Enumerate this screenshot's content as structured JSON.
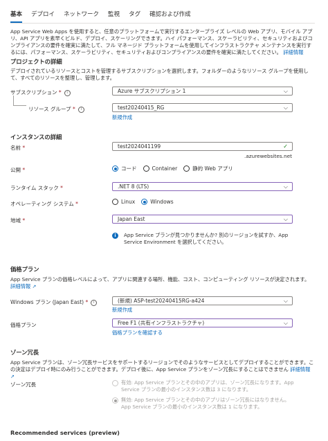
{
  "tabs": [
    "基本",
    "デプロイ",
    "ネットワーク",
    "監視",
    "タグ",
    "確認および作成"
  ],
  "intro": {
    "text": "App Service Web Apps を使用すると、任意のプラットフォームで実行するエンタープライズ レベルの Web アプリ、モバイル アプリ、API アプリを素早くビルド、デプロイ、スケーリングできます。ハイ パフォーマンス、スケーラビリティ、セキュリティおよびコンプライアンスの要件を確実に満たして、フル マネージド プラットフォームを使用してインフラストラクチャ メンテナンスを実行するには、パフォーマンス、スケーラビリティ、セキュリティおよびコンプライアンスの要件を確実に満たしてください。",
    "link": "詳細情報"
  },
  "project": {
    "heading": "プロジェクトの詳細",
    "desc": "デプロイされているリソースとコストを管理するサブスクリプションを選択します。フォルダーのようなリソース グループを使用して、すべてのリソースを整理し、管理します。",
    "subscription_label": "サブスクリプション",
    "subscription_value": "Azure サブスクリプション 1",
    "rg_label": "リソース グループ",
    "rg_value": "test20240415_RG",
    "create_new": "新規作成"
  },
  "instance": {
    "heading": "インスタンスの詳細",
    "name_label": "名前",
    "name_value": "test2024041199",
    "domain_suffix": ".azurewebsites.net",
    "publish_label": "公開",
    "publish_options": [
      "コード",
      "Container",
      "静的 Web アプリ"
    ],
    "publish_selected": "コード",
    "runtime_label": "ランタイム スタック",
    "runtime_value": ".NET 8 (LTS)",
    "os_label": "オペレーティング システム",
    "os_options": [
      "Linux",
      "Windows"
    ],
    "os_selected": "Windows",
    "region_label": "地域",
    "region_value": "Japan East",
    "region_info": "App Service プランが見つかりませんか? 別のリージョンを試すか、App Service Environment を選択してください。"
  },
  "pricing": {
    "heading": "価格プラン",
    "desc": "App Service プランの価格レベルによって、アプリに関連する場所、機能、コスト、コンピューティング リソースが決定されます。",
    "link": "詳細情報",
    "plan_label": "Windows プラン (Japan East)",
    "plan_value": "(新規) ASP-test20240415RG-a424",
    "create_new": "新規作成",
    "tier_label": "価格プラン",
    "tier_value": "Free F1 (共有インフラストラクチャ)",
    "explore": "価格プランを確認する"
  },
  "zone": {
    "heading": "ゾーン冗長",
    "desc": "App Service プランは、ゾーン冗長サービスをサポートするリージョンでそのようなサービスとしてデプロイすることができます。この決定はデプロイ時にのみ行うことができます。デプロイ後に、App Service プランをゾーン冗長にすることはできません",
    "link": "詳細情報",
    "label": "ゾーン冗長",
    "enabled": "有効: App Service プランとその中のアプリは、ゾーン冗長になります。App Service プランの最小のインスタンス数は 3 になります。",
    "disabled": "無効: App Service プランとその中のアプリはゾーン冗長にはなりません。App Service プランの最小のインスタンス数は 1 になります。"
  },
  "recommended": {
    "heading": "Recommended services (preview)"
  },
  "colors": {
    "accent": "#0f6cbd",
    "required": "#a4262c",
    "valid": "#107c10"
  }
}
